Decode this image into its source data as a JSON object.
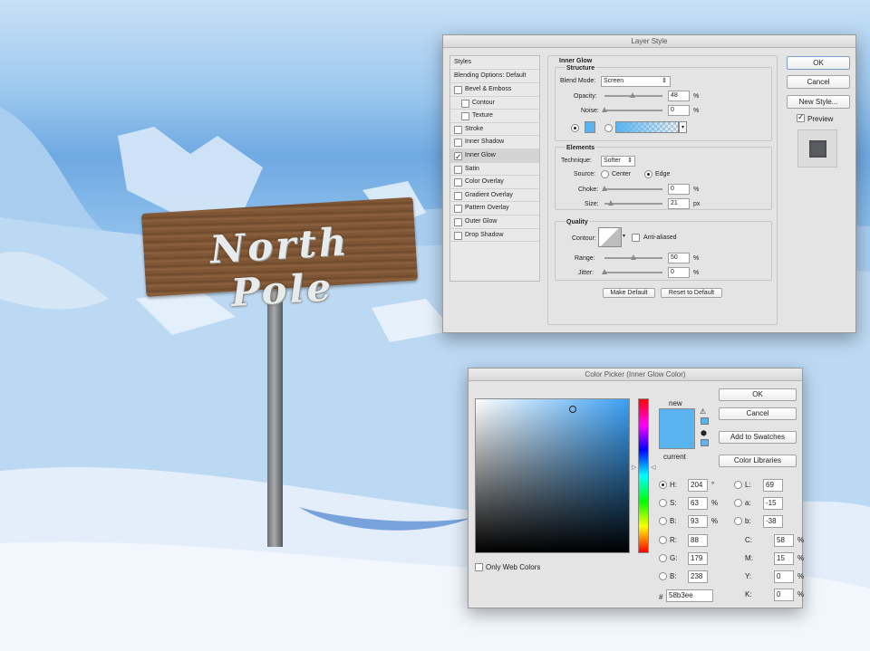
{
  "layer_style": {
    "title": "Layer Style",
    "styles_header": "Styles",
    "blending_options": "Blending Options: Default",
    "style_items": [
      {
        "label": "Bevel & Emboss",
        "checked": false
      },
      {
        "label": "Contour",
        "checked": false
      },
      {
        "label": "Texture",
        "checked": false
      },
      {
        "label": "Stroke",
        "checked": false
      },
      {
        "label": "Inner Shadow",
        "checked": false
      },
      {
        "label": "Inner Glow",
        "checked": true
      },
      {
        "label": "Satin",
        "checked": false
      },
      {
        "label": "Color Overlay",
        "checked": false
      },
      {
        "label": "Gradient Overlay",
        "checked": false
      },
      {
        "label": "Pattern Overlay",
        "checked": false
      },
      {
        "label": "Outer Glow",
        "checked": false
      },
      {
        "label": "Drop Shadow",
        "checked": false
      }
    ],
    "section_title": "Inner Glow",
    "structure": {
      "title": "Structure",
      "blend_mode_label": "Blend Mode:",
      "blend_mode_value": "Screen",
      "opacity_label": "Opacity:",
      "opacity_value": "48",
      "noise_label": "Noise:",
      "noise_value": "0",
      "percent": "%",
      "glow_color": "#58b3ee"
    },
    "elements": {
      "title": "Elements",
      "technique_label": "Technique:",
      "technique_value": "Softer",
      "source_label": "Source:",
      "source_center": "Center",
      "source_edge": "Edge",
      "choke_label": "Choke:",
      "choke_value": "0",
      "size_label": "Size:",
      "size_value": "21",
      "size_unit": "px"
    },
    "quality": {
      "title": "Quality",
      "contour_label": "Contour:",
      "anti_aliased_label": "Anti-aliased",
      "range_label": "Range:",
      "range_value": "50",
      "jitter_label": "Jitter:",
      "jitter_value": "0"
    },
    "make_default": "Make Default",
    "reset_default": "Reset to Default",
    "ok": "OK",
    "cancel": "Cancel",
    "new_style": "New Style...",
    "preview_label": "Preview"
  },
  "color_picker": {
    "title": "Color Picker (Inner Glow Color)",
    "new_label": "new",
    "current_label": "current",
    "ok": "OK",
    "cancel": "Cancel",
    "add_to_swatches": "Add to Swatches",
    "color_libraries": "Color Libraries",
    "only_web_colors": "Only Web Colors",
    "hsb": [
      {
        "label": "H:",
        "value": "204",
        "unit": "°"
      },
      {
        "label": "S:",
        "value": "63",
        "unit": "%"
      },
      {
        "label": "B:",
        "value": "93",
        "unit": "%"
      }
    ],
    "rgb": [
      {
        "label": "R:",
        "value": "88"
      },
      {
        "label": "G:",
        "value": "179"
      },
      {
        "label": "B:",
        "value": "238"
      }
    ],
    "lab": [
      {
        "label": "L:",
        "value": "69"
      },
      {
        "label": "a:",
        "value": "-15"
      },
      {
        "label": "b:",
        "value": "-38"
      }
    ],
    "cmyk": [
      {
        "label": "C:",
        "value": "58",
        "unit": "%"
      },
      {
        "label": "M:",
        "value": "15",
        "unit": "%"
      },
      {
        "label": "Y:",
        "value": "0",
        "unit": "%"
      },
      {
        "label": "K:",
        "value": "0",
        "unit": "%"
      }
    ],
    "hex_label": "#",
    "hex_value": "58b3ee",
    "new_color": "#58b3ee",
    "current_color": "#58b3ee"
  },
  "scene": {
    "sign_text": "North Pole"
  }
}
